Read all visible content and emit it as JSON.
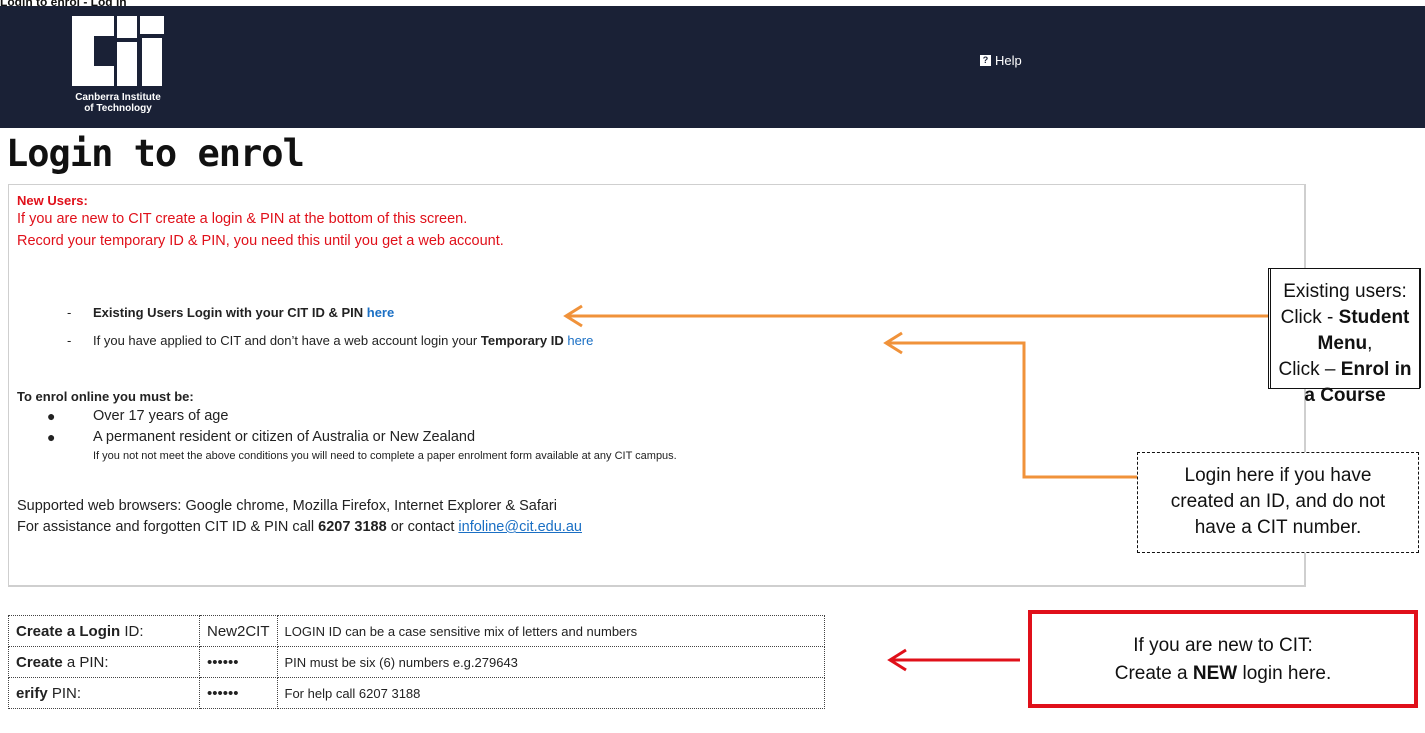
{
  "top_cut_text": "Login to enrol - Log in",
  "logo": {
    "line1": "Canberra Institute",
    "line2": "of Technology"
  },
  "header": {
    "help_label": "Help"
  },
  "page_title": "Login to enrol",
  "panel": {
    "new_users_heading": "New Users:",
    "new_users_line1": "If you are new to CIT create a login & PIN at the bottom of this screen.",
    "new_users_line2": "Record your temporary ID & PIN, you need this until you get a web account.",
    "existing_prefix": "Existing Users Login with your CIT ID & PIN",
    "existing_link": "here",
    "temp_prefix": "If you have applied to CIT and don’t have a web account login your",
    "temp_bold": "Temporary ID",
    "temp_link": "here",
    "requirements_heading": "To enrol online you must be:",
    "req1": "Over 17 years of age",
    "req2": "A permanent resident or citizen of Australia or New Zealand",
    "req_note": "If you not not meet the above conditions you will need to complete a paper enrolment form available at any CIT campus.",
    "browsers": "Supported web browsers: Google chrome, Mozilla Firefox, Internet Explorer & Safari",
    "assist_prefix": "For assistance and forgotten CIT ID & PIN call",
    "assist_phone": "6207 3188",
    "assist_mid": "or contact",
    "assist_email": "infoline@cit.edu.au"
  },
  "callouts": {
    "existing": {
      "line1": "Existing users:",
      "line2a": "Click - ",
      "line2b": "Student Menu",
      "line2c": ",",
      "line3a": "Click – ",
      "line3b": "Enrol in a Course"
    },
    "temp": {
      "line1": "Login here if you have",
      "line2": "created an ID, and do not",
      "line3": "have a CIT number."
    },
    "new": {
      "line1": "If you are new to CIT:",
      "line2a": "Create a ",
      "line2b": "NEW",
      "line2c": " login here."
    }
  },
  "form": {
    "row1": {
      "label_bold": "Create a Login",
      "label_rest": " ID:",
      "value": "New2CIT",
      "hint": "LOGIN ID can be a case sensitive mix of letters and numbers"
    },
    "row2": {
      "label_bold": "Create",
      "label_rest": " a PIN:",
      "value": "••••••",
      "hint": "PIN must be six (6) numbers e.g.279643"
    },
    "row3": {
      "label_bold": "erify",
      "label_rest": " PIN:",
      "value": "••••••",
      "hint": "For help call 6207 3188"
    }
  },
  "colors": {
    "header_bg": "#1a2136",
    "arrow_orange": "#f0923a",
    "arrow_red": "#e0101a",
    "text_red": "#e0101a",
    "link_blue": "#1a6fc4"
  }
}
